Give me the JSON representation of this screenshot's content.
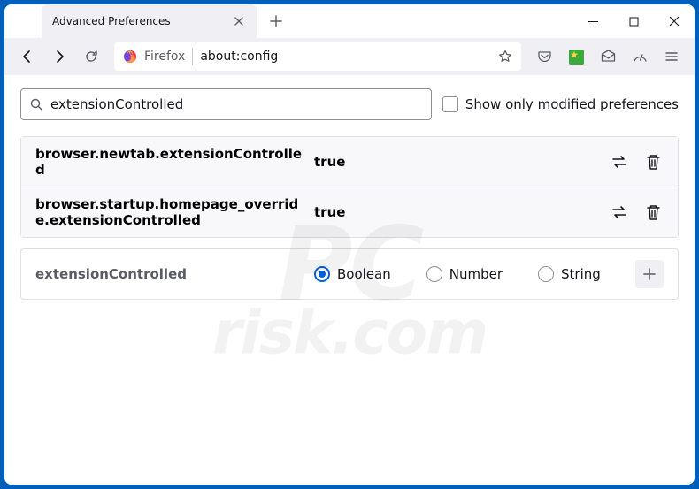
{
  "tab": {
    "title": "Advanced Preferences"
  },
  "urlbar": {
    "identity": "Firefox",
    "url": "about:config"
  },
  "search": {
    "value": "extensionControlled",
    "checkbox_label": "Show only modified preferences"
  },
  "prefs": [
    {
      "name": "browser.newtab.extensionControlled",
      "value": "true"
    },
    {
      "name": "browser.startup.homepage_override.extensionControlled",
      "value": "true"
    }
  ],
  "new_pref": {
    "name": "extensionControlled",
    "types": [
      "Boolean",
      "Number",
      "String"
    ],
    "selected": 0
  },
  "watermark": {
    "top": "PC",
    "bot": "risk.com"
  }
}
